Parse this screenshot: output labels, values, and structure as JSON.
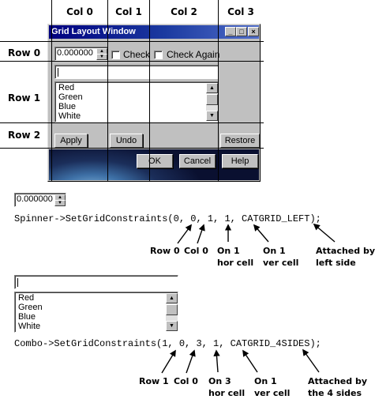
{
  "columns": [
    "Col 0",
    "Col 1",
    "Col 2",
    "Col 3"
  ],
  "rows": [
    "Row 0",
    "Row 1",
    "Row 2"
  ],
  "window": {
    "title": "Grid Layout Window",
    "spinner_value": "0.000000",
    "check_label": "Check",
    "check_again_label": "Check Again",
    "list_items": [
      "Red",
      "Green",
      "Blue",
      "White"
    ],
    "apply_label": "Apply",
    "undo_label": "Undo",
    "restore_label": "Restore",
    "ok_label": "OK",
    "cancel_label": "Cancel",
    "help_label": "Help",
    "minimize_glyph": "_",
    "maximize_glyph": "□",
    "close_glyph": "×"
  },
  "spinner_example": {
    "value": "0.000000",
    "code": "Spinner->SetGridConstraints(0, 0, 1, 1, CATGRID_LEFT);",
    "annotations": [
      [
        "Row 0"
      ],
      [
        "Col 0"
      ],
      [
        "On 1",
        "hor cell"
      ],
      [
        "On 1",
        "ver cell"
      ],
      [
        "Attached by",
        "left side"
      ]
    ]
  },
  "combo_example": {
    "list_items": [
      "Red",
      "Green",
      "Blue",
      "White"
    ],
    "code": "Combo->SetGridConstraints(1, 0, 3, 1, CATGRID_4SIDES);",
    "annotations": [
      [
        "Row 1"
      ],
      [
        "Col 0"
      ],
      [
        "On 3",
        "hor cell"
      ],
      [
        "On 1",
        "ver cell"
      ],
      [
        "Attached by",
        "the 4 sides"
      ]
    ]
  },
  "colors": {
    "title_bar": "#000080",
    "window_face": "#c0c0c0"
  }
}
